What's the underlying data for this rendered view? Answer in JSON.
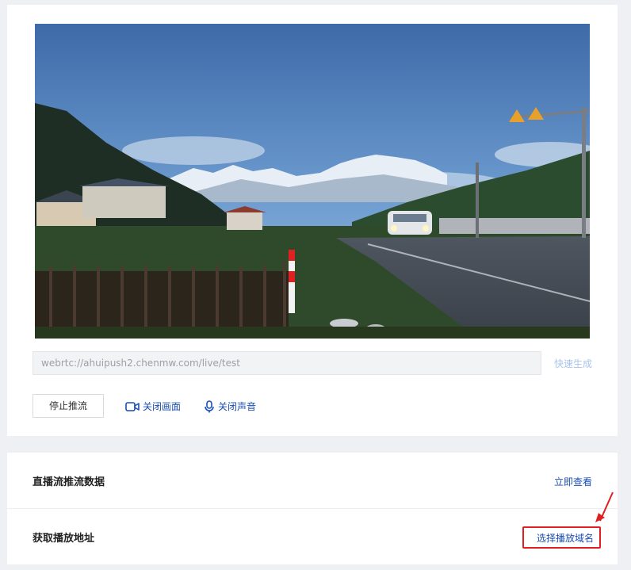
{
  "stream": {
    "url_value": "webrtc://ahuipush2.chenmw.com/live/test",
    "quick_generate_label": "快速生成"
  },
  "controls": {
    "stop_push_label": "停止推流",
    "close_video_label": "关闭画面",
    "close_audio_label": "关闭声音"
  },
  "panel": {
    "push_data_title": "直播流推流数据",
    "push_data_link": "立即查看",
    "play_url_title": "获取播放地址",
    "play_url_link": "选择播放域名"
  },
  "colors": {
    "link": "#1a4fb4",
    "highlight": "#e02020",
    "disabled_link": "#a8c4ec"
  },
  "icons": [
    "video-camera-icon",
    "microphone-icon"
  ]
}
